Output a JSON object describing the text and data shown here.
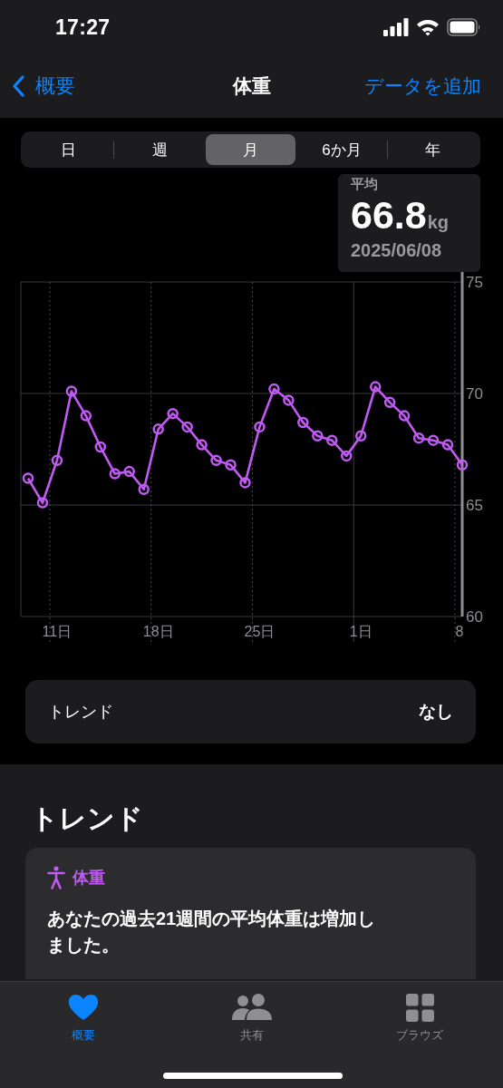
{
  "status_bar": {
    "time": "17:27"
  },
  "nav": {
    "back_label": "概要",
    "title": "体重",
    "action": "データを追加"
  },
  "segments": [
    {
      "label": "日",
      "selected": false
    },
    {
      "label": "週",
      "selected": false
    },
    {
      "label": "月",
      "selected": true
    },
    {
      "label": "6か月",
      "selected": false
    },
    {
      "label": "年",
      "selected": false
    }
  ],
  "summary": {
    "label": "平均",
    "value": "66.8",
    "unit": "kg",
    "date": "2025/06/08"
  },
  "chart_data": {
    "type": "line",
    "categories": [
      null,
      null,
      "11日",
      null,
      null,
      null,
      null,
      null,
      null,
      "18日",
      null,
      null,
      null,
      null,
      null,
      null,
      "25日",
      null,
      null,
      null,
      null,
      null,
      null,
      "1日",
      null,
      null,
      null,
      null,
      null,
      null,
      "8"
    ],
    "grid": true,
    "series": [
      {
        "color": "#bf5af2",
        "marker": "circle",
        "values": [
          66.2,
          65.1,
          67.0,
          70.1,
          69.0,
          67.6,
          66.4,
          66.5,
          65.7,
          68.4,
          69.1,
          68.5,
          67.7,
          67.0,
          66.8,
          66.0,
          68.5,
          70.2,
          69.7,
          68.7,
          68.1,
          67.9,
          67.2,
          68.1,
          70.3,
          69.6,
          69.0,
          68.0,
          67.9,
          67.7,
          66.8
        ]
      }
    ],
    "ylim": [
      60,
      75
    ],
    "yticks": [
      60,
      65,
      70,
      75
    ]
  },
  "trend_row": {
    "label": "トレンド",
    "value": "なし"
  },
  "trends": {
    "title": "トレンド",
    "card": {
      "category": "体重",
      "text": "あなたの過去21週間の平均体重は増加しました。"
    }
  },
  "tab_bar": [
    {
      "kind": "heart",
      "label": "概要",
      "selected": true
    },
    {
      "kind": "people",
      "label": "共有",
      "selected": false
    },
    {
      "kind": "grid",
      "label": "ブラウズ",
      "selected": false
    }
  ]
}
